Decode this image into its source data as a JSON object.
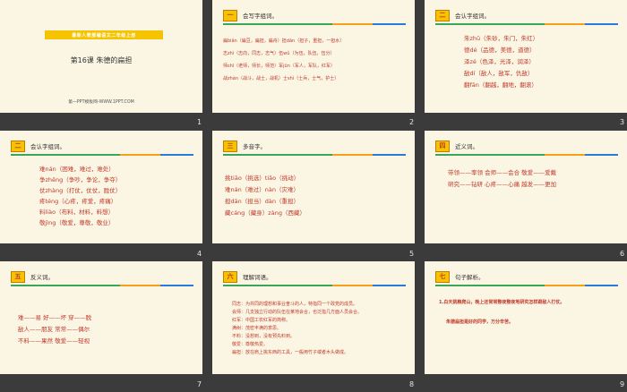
{
  "slides": [
    {
      "num": "1",
      "banner": "最新人教部编语文二年级上册",
      "lesson": "第16课 朱德的扁担",
      "footer": "第一PPT模板网-WWW.1PPT.COM"
    },
    {
      "num": "2",
      "badge": "一",
      "title": "会写字组词。",
      "lines": [
        "扁biǎn（扁豆，扁担，扁舟）担dān（担子，重担，一担水）",
        "志zhì（志向，同志，志气）伍wǔ（为伍，队伍，伍分）",
        "师shī（老师，师长，师范）军jūn（军人，军队，红军）",
        "战zhàn（战斗，战士，战机）士shì（士兵，士气，护士）"
      ]
    },
    {
      "num": "3",
      "badge": "二",
      "title": "会认字组词。",
      "lines": [
        "朱zhū（朱砂，朱门，朱红）",
        "德dé（品德，美德，道德）",
        "泽zé（色泽，光泽，润泽）",
        "敌dí（敌人，敌军，仇敌）",
        "翻fān（翻越，翻地，翻滚）"
      ]
    },
    {
      "num": "4",
      "badge": "二",
      "title": "会认字组词。",
      "lines": [
        "难nán（困难，难过，难处）",
        "争zhēng（争吵，争论，争夺）",
        "仗zhàng（打仗，仗仗，胜仗）",
        "疼téng（心疼，疼爱，疼痛）",
        "料liào（布料，材料，料想）",
        "敬jìng（敬爱，尊敬，敬业）"
      ]
    },
    {
      "num": "5",
      "badge": "三",
      "title": "多音字。",
      "lines": [
        "挑tiāo（挑选）tiǎo（挑动）",
        "难nán（难过）nàn（灾难）",
        "担dān（担当）dàn（重担）",
        "藏cáng（藏身）zàng（西藏）"
      ]
    },
    {
      "num": "6",
      "badge": "四",
      "title": "近义词。",
      "lines": [
        "带领——率领 会师——会合 敬爱——爱戴",
        "研究——钻研 心疼——心痛 越发——更加"
      ]
    },
    {
      "num": "7",
      "badge": "五",
      "title": "反义词。",
      "lines": [
        "难——易   好——坏   穿——脱",
        "敌人——朋友   常常——偶尔",
        "不料——果然   敬爱——轻视"
      ]
    },
    {
      "num": "8",
      "badge": "六",
      "title": "理解词语。",
      "lines": [
        "同志：为共同的理想和事业奋斗的人，特指同一个政党的成员。",
        "会师：几支独立行动的队伍在某地会合，也泛指几方面人员会合。",
        "红军：中国工农红军的简称。",
        "满树：茂密丰满的意思。",
        "不料：没想到，没有预先料到。",
        "敬爱：尊敬热爱。",
        "扁担：放在肩上挑东西的工具，一般用竹子或者木头做成。"
      ]
    },
    {
      "num": "9",
      "badge": "七",
      "title": "句子解析。",
      "lines": [
        "1.白天挑粮爬山，晚上还常常整夜整夜地研究怎样跟敌人打仗。",
        "朱德扁担是好的同学，万分辛苦。"
      ]
    }
  ]
}
